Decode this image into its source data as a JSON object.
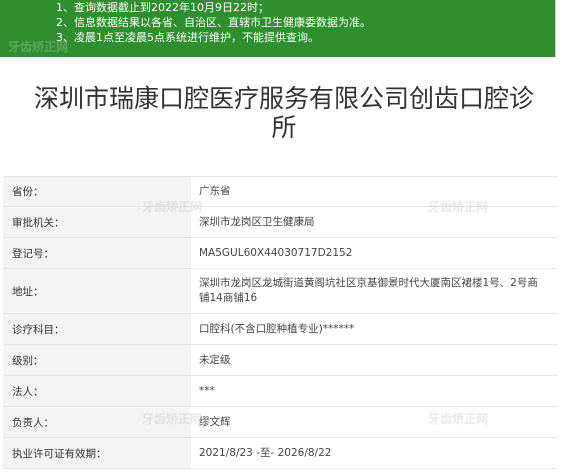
{
  "notice": {
    "lines": [
      "1、查询数据截止到2022年10月9日22时；",
      "2、信息数据结果以各省、自治区、直辖市卫生健康委数据为准。",
      "3、凌晨1点至凌晨5点系统进行维护，不能提供查询。"
    ]
  },
  "title": {
    "line1": "深圳市瑞康口腔医疗服务有限公司创齿口腔诊",
    "line2": "所"
  },
  "rows": [
    {
      "label": "省份：",
      "value": "广东省"
    },
    {
      "label": "审批机关：",
      "value": "深圳市龙岗区卫生健康局"
    },
    {
      "label": "登记号：",
      "value": "MA5GUL60X44030717D2152"
    },
    {
      "label": "地址：",
      "value": "深圳市龙岗区龙城街道黄阁坑社区京基御景时代大厦南区裙楼1号、2号商铺14商铺16"
    },
    {
      "label": "诊疗科目：",
      "value": "口腔科(不含口腔种植专业)******"
    },
    {
      "label": "级别：",
      "value": "未定级"
    },
    {
      "label": "法人：",
      "value": "***"
    },
    {
      "label": "负责人：",
      "value": "缪文辉"
    },
    {
      "label": "执业许可证有效期：",
      "value": "2021/8/23 -至- 2026/8/22"
    }
  ],
  "watermark": {
    "text": "牙齿矫正网"
  }
}
